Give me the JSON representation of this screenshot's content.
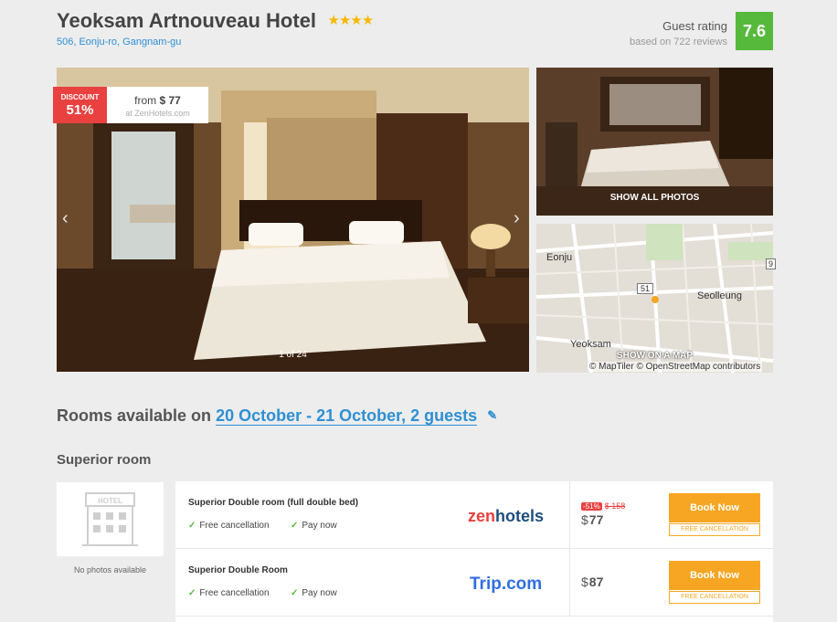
{
  "hotel": {
    "name": "Yeoksam Artnouveau Hotel",
    "stars": "★★★★",
    "address": "506, Eonju-ro, Gangnam-gu"
  },
  "rating": {
    "label": "Guest rating",
    "subtitle": "based on 722 reviews",
    "score": "7.6",
    "color": "#56b93c"
  },
  "gallery": {
    "discount_label": "DISCOUNT",
    "discount_value": "51%",
    "from_prefix": "from",
    "from_currency": "$",
    "from_amount": "77",
    "from_site": "at ZenHotels.com",
    "counter": "1 of 24",
    "prev_icon": "chevron-left-icon",
    "next_icon": "chevron-right-icon",
    "show_all_photos": "SHOW ALL PHOTOS",
    "show_on_map": "SHOW ON A MAP"
  },
  "map": {
    "labels": [
      "Eonju",
      "Seolleung",
      "Yeoksam"
    ],
    "road_numbers": [
      "51",
      "9"
    ],
    "credit": "© MapTiler © OpenStreetMap contributors"
  },
  "rooms": {
    "heading_prefix": "Rooms available on",
    "dates": "20 October - 21 October, 2 guests",
    "edit_icon": "pencil-icon",
    "room_type": "Superior room",
    "no_photos": "No photos available",
    "offers": [
      {
        "name": "Superior Double room (full double bed)",
        "features": [
          "Free cancellation",
          "Pay now"
        ],
        "provider": "zenhotels",
        "old_pct": "-51%",
        "old_price": "$ 158",
        "currency": "$",
        "price": "77",
        "button": "Book Now",
        "note": "FREE CANCELLATION"
      },
      {
        "name": "Superior Double Room",
        "features": [
          "Free cancellation",
          "Pay now"
        ],
        "provider": "Trip.com",
        "currency": "$",
        "price": "87",
        "button": "Book Now",
        "note": "FREE CANCELLATION"
      }
    ]
  },
  "colors": {
    "accent_blue": "#2e8fd4",
    "discount_red": "#e8413f",
    "book_orange": "#f6a623"
  }
}
